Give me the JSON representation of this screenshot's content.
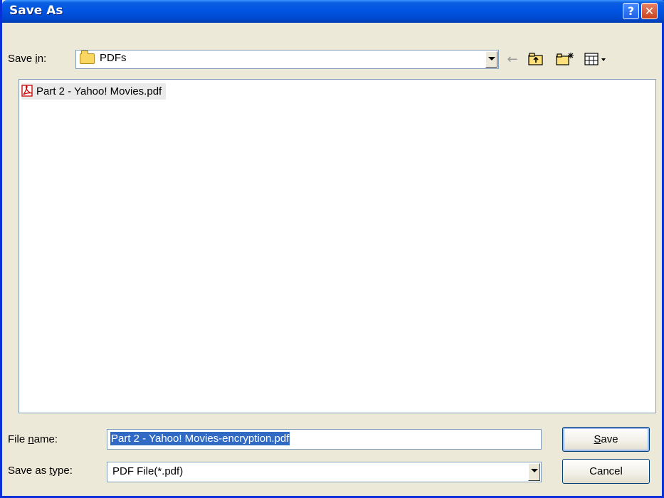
{
  "window": {
    "title": "Save As"
  },
  "titlebar_buttons": {
    "help": "?",
    "close": "✕"
  },
  "save_in": {
    "label_pre": "Save ",
    "label_u": "i",
    "label_post": "n:",
    "value": "PDFs",
    "icon": "folder-icon"
  },
  "toolbar": {
    "back_icon": "back-arrow-icon",
    "up_icon": "up-folder-icon",
    "new_folder_icon": "new-folder-icon",
    "views_icon": "views-menu-icon"
  },
  "files": [
    {
      "name": "Part 2 - Yahoo! Movies.pdf",
      "icon": "pdf-file-icon"
    }
  ],
  "file_name": {
    "label_pre": "File ",
    "label_u": "n",
    "label_post": "ame:",
    "value": "Part 2 - Yahoo! Movies-encryption.pdf"
  },
  "save_as_type": {
    "label_pre": "Save as ",
    "label_u": "t",
    "label_post": "ype:",
    "value": "PDF File(*.pdf)"
  },
  "buttons": {
    "save_u": "S",
    "save_rest": "ave",
    "cancel": "Cancel"
  },
  "colors": {
    "title_bar": "#0054e3",
    "dialog_bg": "#ece9d8",
    "selection": "#316ac5",
    "close_button": "#c8421d"
  }
}
